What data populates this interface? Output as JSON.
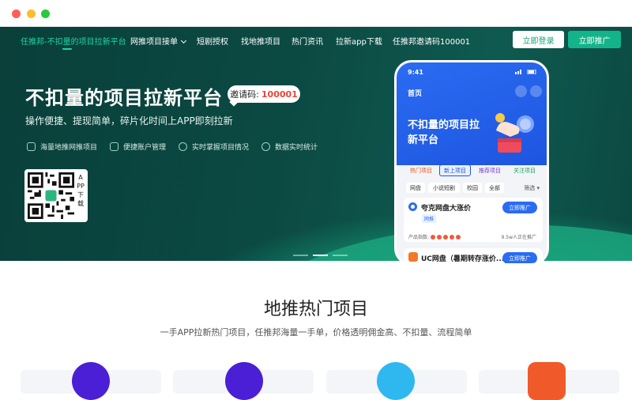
{
  "nav": {
    "brand": "任推邦-不扣量的项目拉新平台",
    "items": [
      "网推项目接单",
      "短剧授权",
      "找地推项目",
      "热门资讯",
      "拉新app下载",
      "任推邦邀请码100001"
    ],
    "login_label": "立即登录",
    "promote_label": "立即推广"
  },
  "hero": {
    "title": "不扣量的项目拉新平台",
    "invite_label": "邀请码:",
    "invite_code": "100001",
    "subtitle": "操作便捷、提现简单，碎片化时间上APP即刻拉新",
    "features": [
      "海量地推网推项目",
      "便捷账户管理",
      "实时掌握项目情况",
      "数据实时统计"
    ],
    "qr_label": "APP下载"
  },
  "phone": {
    "time": "9:41",
    "home_label": "首页",
    "banner_title": "不扣量的项目拉新平台",
    "tabs": [
      "热门项目",
      "新上项目",
      "推荐项目",
      "关注项目"
    ],
    "chips": [
      "网盘",
      "小说短剧",
      "校园",
      "全部"
    ],
    "filter_label": "筛选",
    "card1": {
      "title": "夸克网盘大涨价",
      "badge": "网推",
      "button": "立即推广",
      "metric_label": "产品指数:",
      "promoting": "9.5w人正在推广"
    },
    "card2": {
      "title": "UC网盘（暑期转存涨价...",
      "button": "立即推广"
    }
  },
  "section": {
    "title": "地推热门项目",
    "subtitle": "一手APP拉新热门项目，任推邦海量一手单，价格透明佣金高、不扣量、流程简单"
  },
  "colors": {
    "accent": "#14b48a",
    "brand_active": "#1fd4a2",
    "hero_bg": "#0b4a43",
    "phone_blue": "#2a6cf2",
    "invite_red": "#e6463a"
  }
}
